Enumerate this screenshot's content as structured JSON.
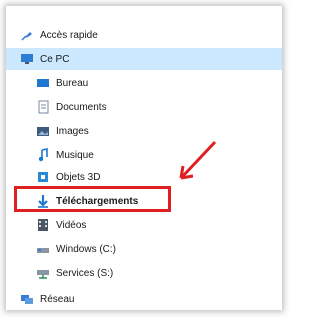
{
  "nav": {
    "quick_access": "Accès rapide",
    "this_pc": "Ce PC",
    "items": [
      {
        "label": "Bureau",
        "icon": "desktop-icon"
      },
      {
        "label": "Documents",
        "icon": "document-icon"
      },
      {
        "label": "Images",
        "icon": "image-icon"
      },
      {
        "label": "Musique",
        "icon": "music-icon"
      },
      {
        "label": "Objets 3D",
        "icon": "objects-3d-icon"
      },
      {
        "label": "Téléchargements",
        "icon": "download-icon"
      },
      {
        "label": "Vidéos",
        "icon": "video-icon"
      },
      {
        "label": "Windows (C:)",
        "icon": "drive-icon"
      },
      {
        "label": "Services (S:)",
        "icon": "network-drive-icon"
      }
    ],
    "network": "Réseau"
  },
  "colors": {
    "highlight": "#e02020",
    "selected_bg": "#cce8ff",
    "accent": "#1e78d2"
  }
}
